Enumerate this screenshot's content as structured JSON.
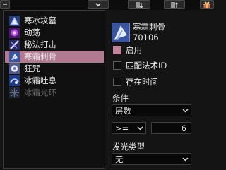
{
  "aura_list": [
    {
      "label": "寒冰坟墓",
      "icon": "ice-tomb-icon",
      "selected": false,
      "enabled": true
    },
    {
      "label": "动荡",
      "icon": "unstable-icon",
      "selected": false,
      "enabled": true
    },
    {
      "label": "秘法打击",
      "icon": "arcane-strike-icon",
      "selected": false,
      "enabled": true
    },
    {
      "label": "寒霜刺骨",
      "icon": "frost-bite-icon",
      "selected": true,
      "enabled": true
    },
    {
      "label": "狂咒",
      "icon": "frenzied-curse-icon",
      "selected": false,
      "enabled": true
    },
    {
      "label": "冰霜吐息",
      "icon": "frost-breath-icon",
      "selected": false,
      "enabled": true
    },
    {
      "label": "冰霜光环",
      "icon": "frost-aura-icon",
      "selected": false,
      "enabled": false
    }
  ],
  "detail": {
    "name": "寒霜刺骨",
    "spell_id": "70106",
    "enabled_label": "启用",
    "enabled_checked": true,
    "match_id_label": "匹配法术ID",
    "match_id_checked": false,
    "show_duration_label": "存在时间",
    "show_duration_checked": false,
    "condition_label": "条件",
    "condition_value": "层数",
    "operator_value": ">=",
    "threshold_value": "6",
    "glow_label": "发光类型",
    "glow_value": "无"
  },
  "colors": {
    "accent": "#b07a90",
    "checked": "#c0859d"
  }
}
